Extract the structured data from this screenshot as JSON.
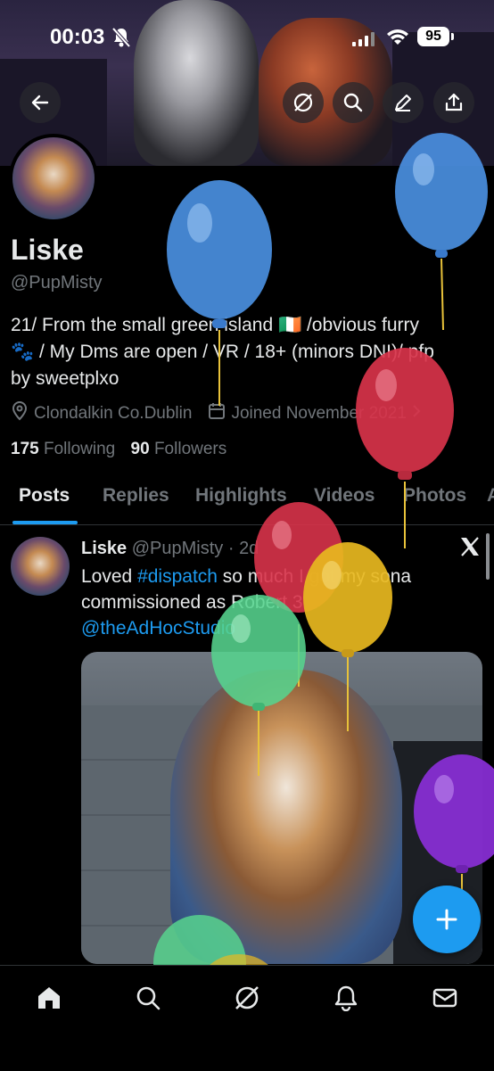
{
  "status_bar": {
    "time": "00:03",
    "battery": "95"
  },
  "header": {
    "back_icon": "arrow-left-icon",
    "action_icons": [
      "grok-icon",
      "search-icon",
      "edit-icon",
      "share-icon"
    ]
  },
  "profile": {
    "name": "Liske",
    "handle": "@PupMisty",
    "bio_line1": "21/ From the small green island 🇮🇪 /obvious furry",
    "bio_line2": "🐾 / My Dms are open / VR / 18+ (minors DNI)/ pfp",
    "bio_line3": "by sweetplxo",
    "location": "Clondalkin Co.Dublin",
    "joined": "Joined November 2021",
    "following_count": "175",
    "following_label": "Following",
    "followers_count": "90",
    "followers_label": "Followers"
  },
  "tabs": [
    {
      "label": "Posts",
      "active": true
    },
    {
      "label": "Replies"
    },
    {
      "label": "Highlights"
    },
    {
      "label": "Videos"
    },
    {
      "label": "Photos"
    },
    {
      "label": "A"
    }
  ],
  "post": {
    "author": "Liske",
    "handle": "@PupMisty",
    "separator": "·",
    "time": "2d",
    "text_1": "Loved ",
    "hashtag": "#dispatch",
    "text_2": " so much I got my sona commissioned as Robert 3",
    "mention": "@theAdHocStudio"
  },
  "bottom_nav": [
    "home-icon",
    "search-icon",
    "grok-icon",
    "notifications-icon",
    "messages-icon"
  ],
  "colors": {
    "accent": "#1d9bf0",
    "text": "#e7e9ea",
    "muted": "#71767b",
    "balloon_blue": "#4a8fe0",
    "balloon_red": "#d8334a",
    "balloon_yellow": "#e8b820",
    "balloon_green": "#57d48e",
    "balloon_purple": "#8a2fd8"
  }
}
